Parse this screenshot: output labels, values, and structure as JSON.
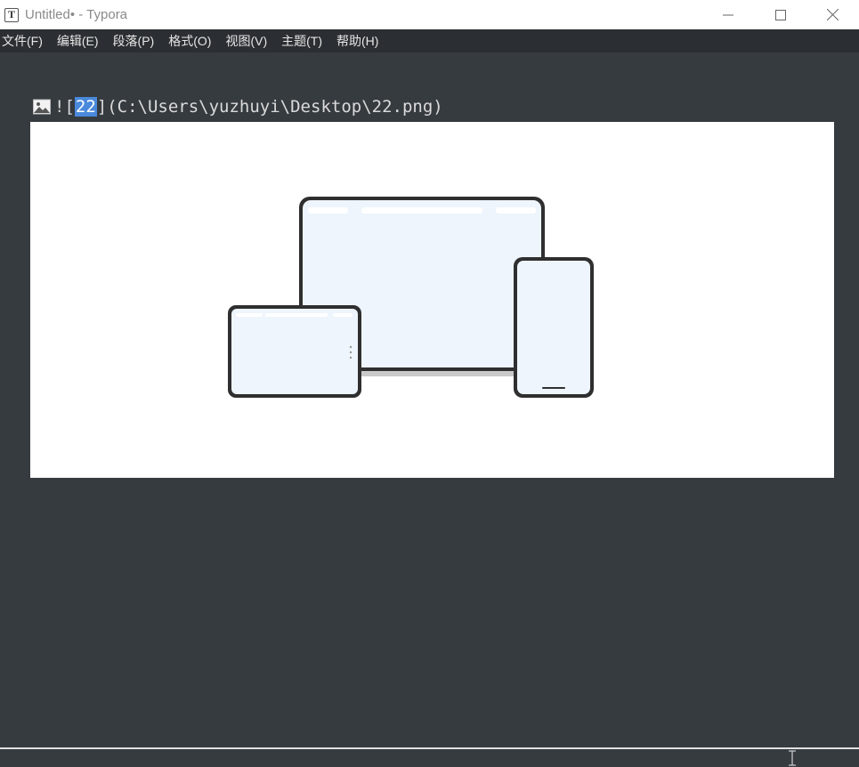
{
  "window": {
    "title": "Untitled• - Typora",
    "app_icon_letter": "T"
  },
  "menubar": {
    "items": [
      "文件(F)",
      "编辑(E)",
      "段落(P)",
      "格式(O)",
      "视图(V)",
      "主题(T)",
      "帮助(H)"
    ]
  },
  "editor": {
    "image_markup_prefix": "![",
    "image_alt_selected": "22",
    "image_markup_suffix": "](C:\\Users\\yuzhuyi\\Desktop\\22.png)"
  },
  "colors": {
    "editor_bg": "#363b40",
    "menubar_bg": "#2b2f33",
    "selection": "#4a89dc"
  }
}
